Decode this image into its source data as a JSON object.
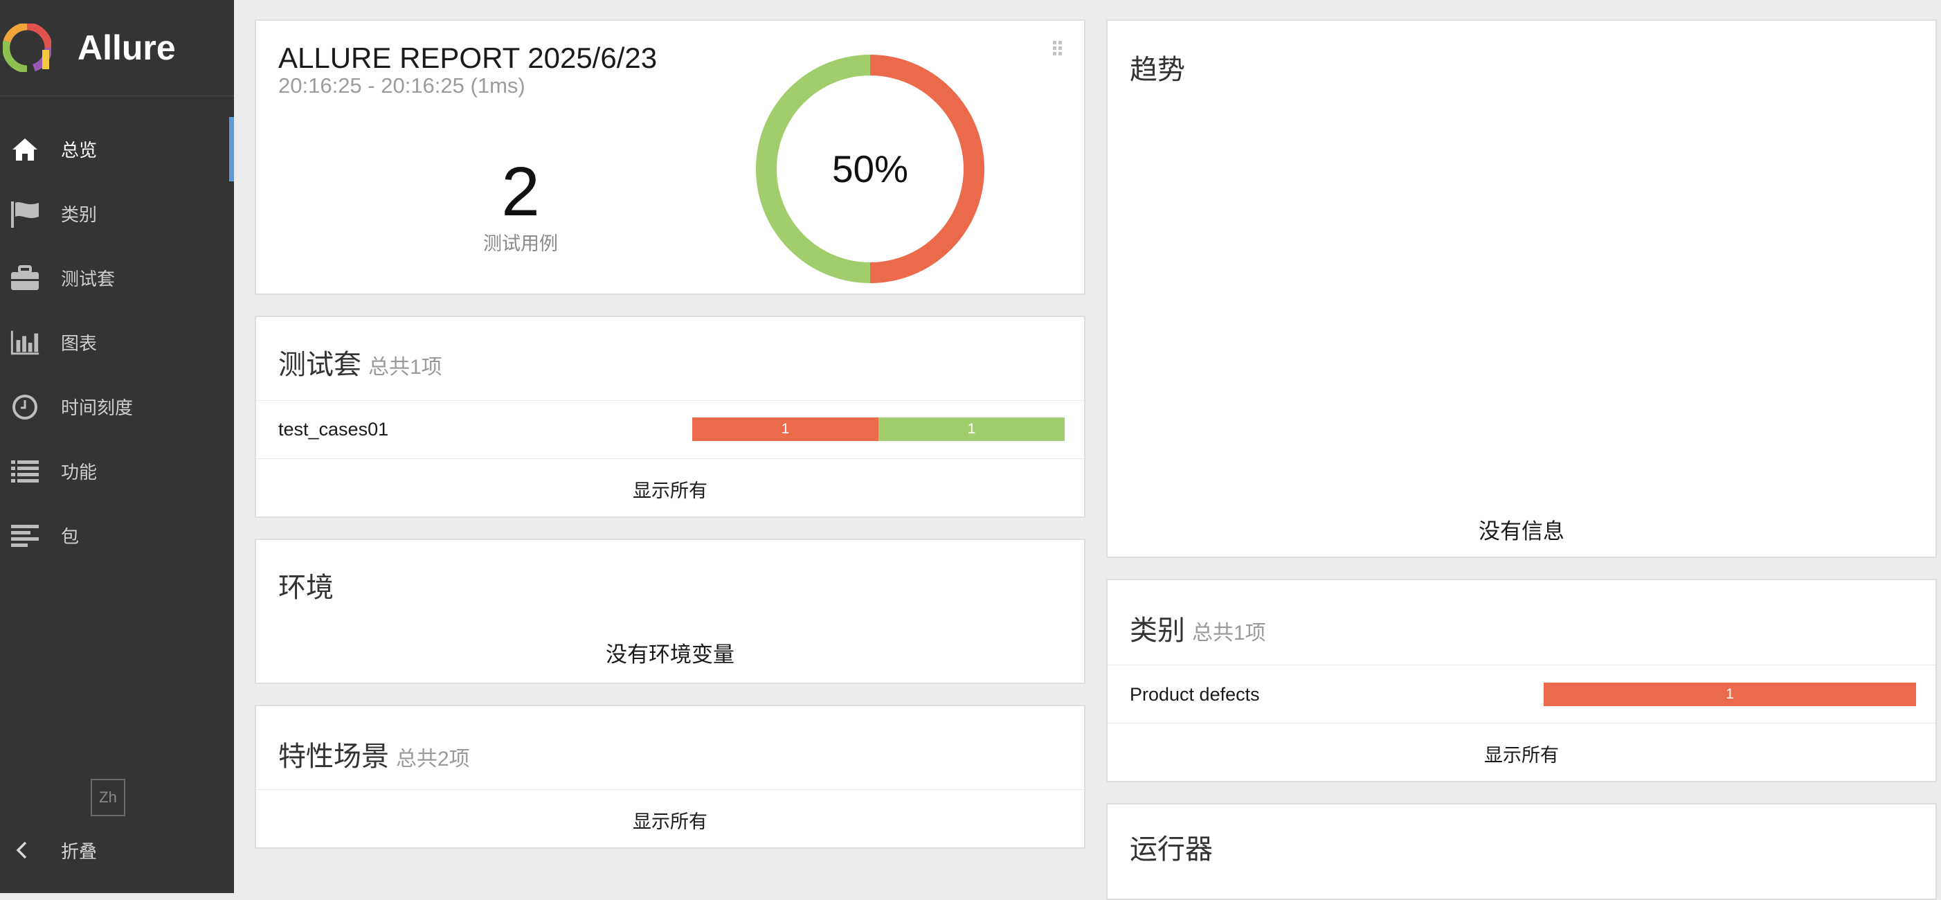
{
  "app": {
    "name": "Allure"
  },
  "sidebar": {
    "items": [
      {
        "label": "总览",
        "icon": "home-icon",
        "active": true
      },
      {
        "label": "类别",
        "icon": "flag-icon"
      },
      {
        "label": "测试套",
        "icon": "briefcase-icon"
      },
      {
        "label": "图表",
        "icon": "bar-chart-icon"
      },
      {
        "label": "时间刻度",
        "icon": "clock-icon"
      },
      {
        "label": "功能",
        "icon": "list-icon"
      },
      {
        "label": "包",
        "icon": "align-left-icon"
      }
    ],
    "lang": "Zh",
    "collapse": "折叠"
  },
  "summary": {
    "title": "ALLURE REPORT 2025/6/23",
    "time": "20:16:25 - 20:16:25 (1ms)",
    "test_count": "2",
    "test_label": "测试用例",
    "percent": "50%",
    "donut": {
      "failed": 1,
      "passed": 1,
      "failed_color": "#ec6a4c",
      "passed_color": "#a2cd6c"
    }
  },
  "suites": {
    "title": "测试套",
    "count": "总共1项",
    "rows": [
      {
        "name": "test_cases01",
        "failed": "1",
        "passed": "1"
      }
    ],
    "show_all": "显示所有"
  },
  "environment": {
    "title": "环境",
    "empty": "没有环境变量"
  },
  "features": {
    "title": "特性场景",
    "count": "总共2项",
    "show_all": "显示所有"
  },
  "trend": {
    "title": "趋势",
    "empty": "没有信息"
  },
  "categories": {
    "title": "类别",
    "count": "总共1项",
    "rows": [
      {
        "name": "Product defects",
        "failed": "1"
      }
    ],
    "show_all": "显示所有"
  },
  "executors": {
    "title": "运行器"
  },
  "colors": {
    "sidebar": "#343434",
    "accent": "#5a9be0",
    "failed": "#ec6a4c",
    "passed": "#a2cd6c"
  }
}
